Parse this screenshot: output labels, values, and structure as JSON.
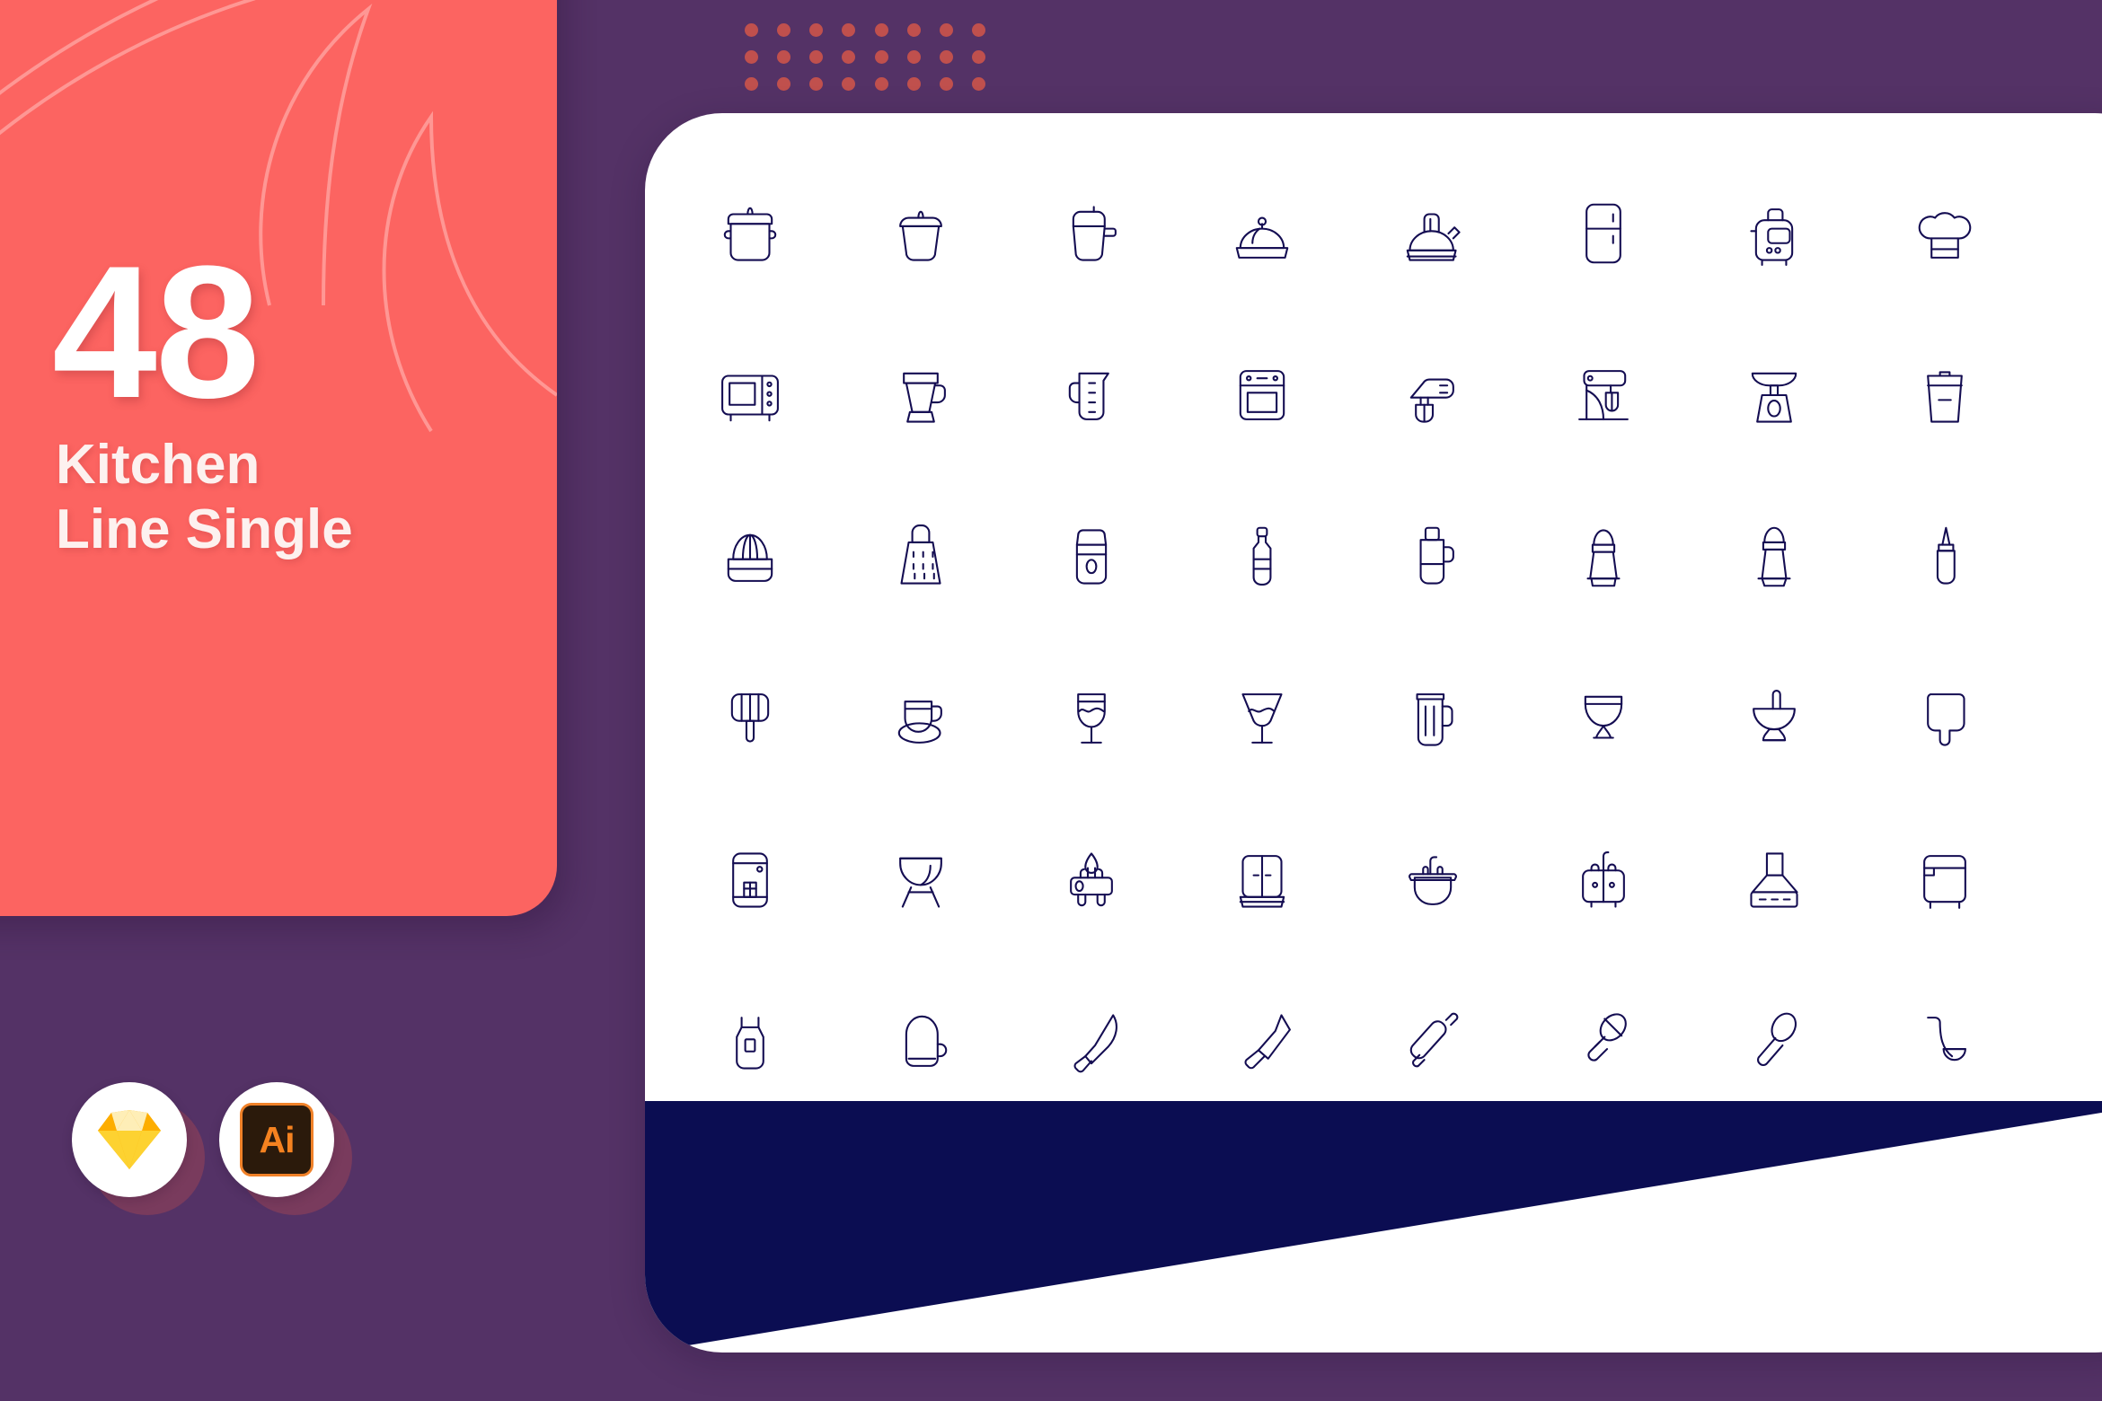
{
  "theme": {
    "background_purple": "#543266",
    "card_coral": "#fc6461",
    "card_white": "#ffffff",
    "icon_navy": "#140d52",
    "fold_navy": "#0b0d52",
    "dot_red": "#c0504d",
    "badge_shadow": "#8f4057",
    "ai_orange": "#f58220",
    "ai_dark": "#2b1a0b"
  },
  "cover": {
    "count": "48",
    "title_line1": "Kitchen",
    "title_line2": "Line Single"
  },
  "badges": [
    {
      "name": "sketch",
      "label": ""
    },
    {
      "name": "illustrator",
      "label": "Ai"
    }
  ],
  "icon_set": {
    "total": 48,
    "columns": 8,
    "rows": 6,
    "icons": [
      "cooking-pot",
      "pot-with-lid",
      "saucepan",
      "cloche-food-cover",
      "kettle",
      "refrigerator",
      "toaster",
      "chef-hat",
      "microwave",
      "blender",
      "measuring-cup",
      "oven",
      "hand-mixer",
      "stand-mixer",
      "kitchen-scale",
      "trash-bin",
      "citrus-juicer",
      "cheese-grater",
      "storage-jar",
      "sauce-bottle",
      "thermos-flask",
      "salt-shaker",
      "pepper-shaker",
      "squeeze-bottle",
      "spatula-turner",
      "teacup-saucer",
      "wine-glass",
      "martini-glass",
      "beer-mug",
      "goblet",
      "mortar-pestle",
      "cutting-board",
      "dishwasher",
      "bbq-grill",
      "gas-burner",
      "kitchen-cabinet",
      "kitchen-sink",
      "double-sink",
      "range-hood",
      "chest-freezer",
      "apron",
      "oven-mitt",
      "chef-knife",
      "cleaver",
      "rolling-pin",
      "pastry-brush",
      "spoon",
      "ladle"
    ]
  }
}
